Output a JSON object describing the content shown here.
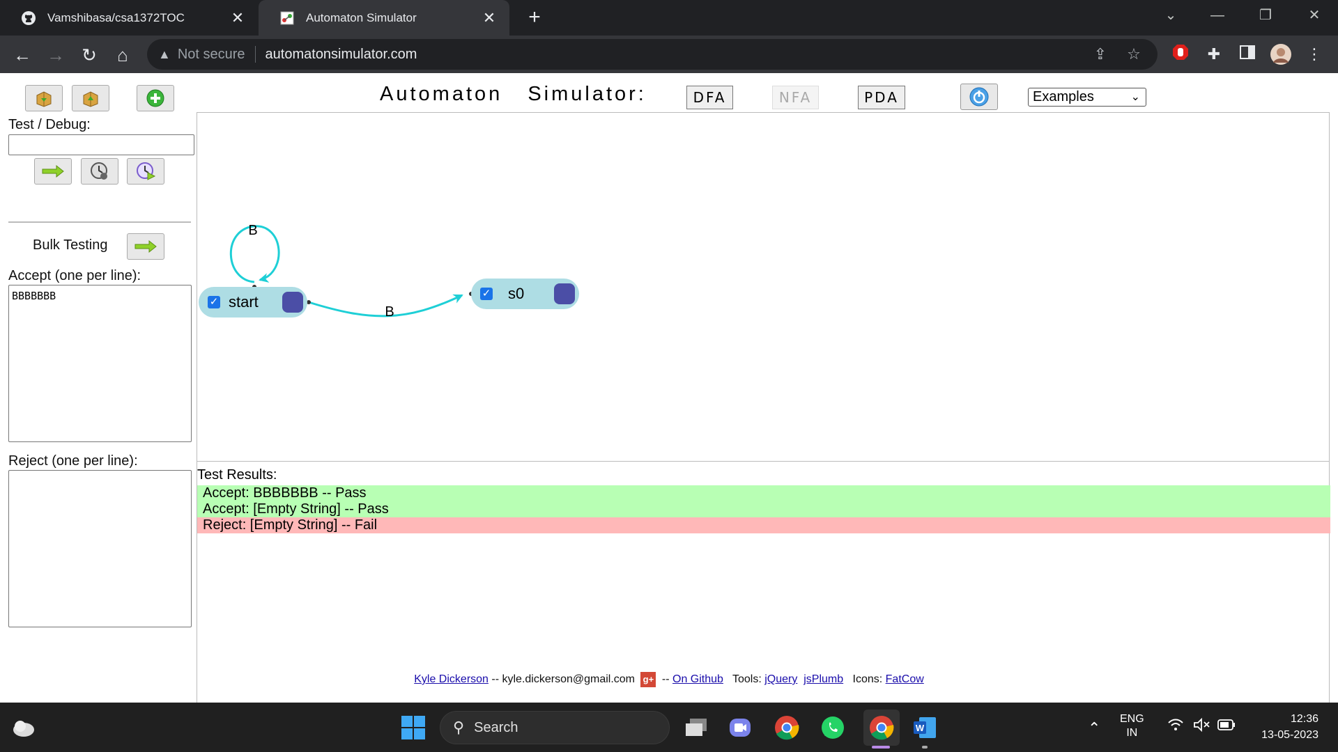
{
  "browser": {
    "tabs": [
      {
        "title": "Vamshibasa/csa1372TOC",
        "icon": "github-icon",
        "close": "✕"
      },
      {
        "title": "Automaton Simulator",
        "icon": "automaton-favicon",
        "close": "✕"
      }
    ],
    "new_tab": "+",
    "window_controls": {
      "dropdown": "⌄",
      "minimize": "—",
      "restore": "❐",
      "close": "✕"
    },
    "nav": {
      "back": "←",
      "forward": "→",
      "reload": "↻",
      "home": "⌂"
    },
    "security_label": "Not secure",
    "url": "automatonsimulator.com"
  },
  "toolbar": {
    "save_icon": "save-icon",
    "load_icon": "load-icon",
    "new_icon": "add-icon"
  },
  "left": {
    "test_label": "Test / Debug:",
    "test_value": "",
    "bulk_label": "Bulk Testing",
    "accept_label": "Accept (one per line):",
    "accept_value": "BBBBBBB",
    "reject_label": "Reject (one per line):",
    "reject_value": ""
  },
  "header": {
    "title": "Automaton Simulator:",
    "modes": [
      {
        "label": "DFA",
        "enabled": true
      },
      {
        "label": "NFA",
        "enabled": false
      },
      {
        "label": "PDA",
        "enabled": true
      }
    ],
    "examples": "Examples"
  },
  "automaton": {
    "states": [
      {
        "name": "start",
        "accepting": true
      },
      {
        "name": "s0",
        "accepting": true
      }
    ],
    "transitions": [
      {
        "from": "start",
        "to": "start",
        "label": "B"
      },
      {
        "from": "start",
        "to": "s0",
        "label": "B"
      }
    ]
  },
  "results": {
    "title": "Test Results:",
    "rows": [
      {
        "text": "Accept: BBBBBBB -- Pass",
        "status": "pass"
      },
      {
        "text": "Accept: [Empty String] -- Pass",
        "status": "pass"
      },
      {
        "text": "Reject: [Empty String] -- Fail",
        "status": "fail"
      }
    ]
  },
  "footer": {
    "author": "Kyle Dickerson",
    "email_text": " -- kyle.dickerson@gmail.com ",
    "gplus": "g+",
    "sep": " -- ",
    "github": "On Github",
    "tools_label": "Tools:",
    "tool1": "jQuery",
    "tool2": "jsPlumb",
    "icons_label": "Icons:",
    "icons_link": "FatCow"
  },
  "taskbar": {
    "search_label": "Search",
    "lang_top": "ENG",
    "lang_bottom": "IN",
    "time": "12:36",
    "date": "13-05-2023"
  },
  "colors": {
    "accent": "#1ecfd6",
    "state_fill": "#aedde4",
    "accept_box": "#4b4ea6",
    "pass_row": "#b8ffb4",
    "fail_row": "#ffb8b8"
  }
}
